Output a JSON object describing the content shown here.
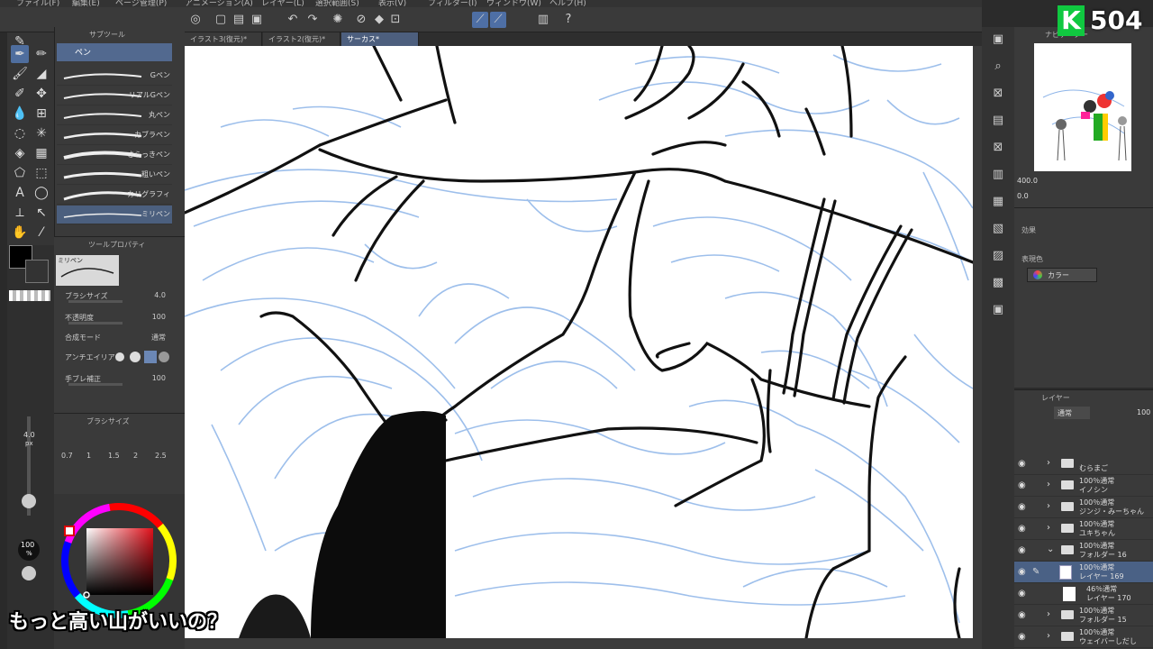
{
  "menubar": {
    "items": [
      "ファイル(F)",
      "編集(E)",
      "ページ管理(P)",
      "アニメーション(A)",
      "レイヤー(L)",
      "選択範囲(S)",
      "表示(V)",
      "フィルター(I)",
      "ウィンドウ(W)",
      "ヘルプ(H)"
    ]
  },
  "canvas_tabs": [
    {
      "label": "イラスト3(復元)*"
    },
    {
      "label": "イラスト2(復元)*"
    },
    {
      "label": "サーカス*"
    }
  ],
  "subtool": {
    "panel_title": "サブツール",
    "group_label": "ペン",
    "brushes": [
      "Gペン",
      "リアルGペン",
      "丸ペン",
      "カブラペン",
      "さらっきペン",
      "粗いペン",
      "カリグラフィ",
      "ミリペン"
    ]
  },
  "tool_property": {
    "title": "ツールプロパティ",
    "brush_name": "ミリペン",
    "rows": [
      {
        "label": "ブラシサイズ",
        "value": "4.0"
      },
      {
        "label": "不透明度",
        "value": "100"
      },
      {
        "label": "合成モード",
        "value": "通常"
      },
      {
        "label": "アンチエイリアス",
        "value": ""
      },
      {
        "label": "手ブレ補正",
        "value": "100"
      }
    ]
  },
  "brush_size": {
    "title": "ブラシサイズ",
    "sizes": [
      "0.7",
      "1",
      "1.5",
      "2",
      "2.5"
    ],
    "current": "4.0",
    "unit": "px",
    "opacity": "100",
    "opacity_unit": "%"
  },
  "navigator": {
    "title": "ナビゲーター",
    "zoom": "400.0",
    "angle": "0.0"
  },
  "effect": {
    "title": "効果",
    "label": "表現色",
    "value": "カラー"
  },
  "layers": {
    "title": "レイヤー",
    "blend": "通常",
    "opacity": "100",
    "items": [
      {
        "line1": "",
        "line2": "むらまご"
      },
      {
        "line1": "100％通常",
        "line2": "イノシン"
      },
      {
        "line1": "100％通常",
        "line2": "ジンジ・みーちゃん"
      },
      {
        "line1": "100％通常",
        "line2": "ユキちゃん"
      },
      {
        "line1": "100％通常",
        "line2": "フォルダー 16"
      },
      {
        "line1": "100％通常",
        "line2": "レイヤー 169"
      },
      {
        "line1": "46％通常",
        "line2": "レイヤー 170"
      },
      {
        "line1": "100％通常",
        "line2": "フォルダー 15"
      },
      {
        "line1": "100％通常",
        "line2": "ウェイバーしだし"
      }
    ]
  },
  "overlay": {
    "logo_letter": "K",
    "logo_number": "504",
    "subtitle": "もっと高い山がいいの？"
  },
  "colors": {
    "accent": "#4f6e9e",
    "sketch_blue": "#8db4e8",
    "logo_green": "#10c840"
  }
}
